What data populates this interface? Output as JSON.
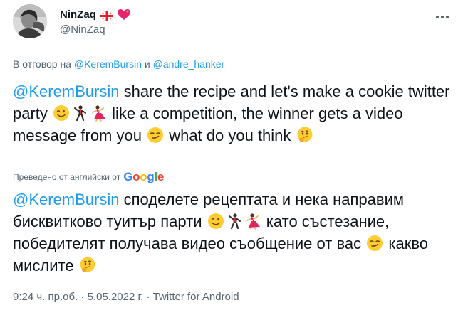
{
  "user": {
    "display_name": "NinZaq",
    "handle": "@NinZaq",
    "flag_icon": "georgia-flag-icon",
    "heart_icon": "sparkling-heart-icon"
  },
  "reply": {
    "prefix": "В отговор на",
    "mention1": "@KeremBursin",
    "joiner": " и ",
    "mention2": "@andre_hanker"
  },
  "tweet": {
    "mention": "@KeremBursin",
    "part1": " share the recipe and let's make a cookie twitter party ",
    "part2": " like a competition, the winner gets a video message from you ",
    "part3": " what do you think "
  },
  "translation": {
    "label": "Преведено от английски от",
    "provider": "Google"
  },
  "translated": {
    "mention": "@KeremBursin",
    "part1": " споделете рецептата и нека направим бисквитково туитър парти ",
    "part2": " като състезание, победителят получава видео съобщение от вас ",
    "part3": " какво мислите "
  },
  "meta": {
    "time": "9:24 ч. пр.об.",
    "sep": " · ",
    "date": "5.05.2022 г.",
    "source": "Twitter for Android"
  },
  "colors": {
    "accent": "#1d9bf0",
    "muted": "#536471",
    "text": "#0f1419"
  }
}
